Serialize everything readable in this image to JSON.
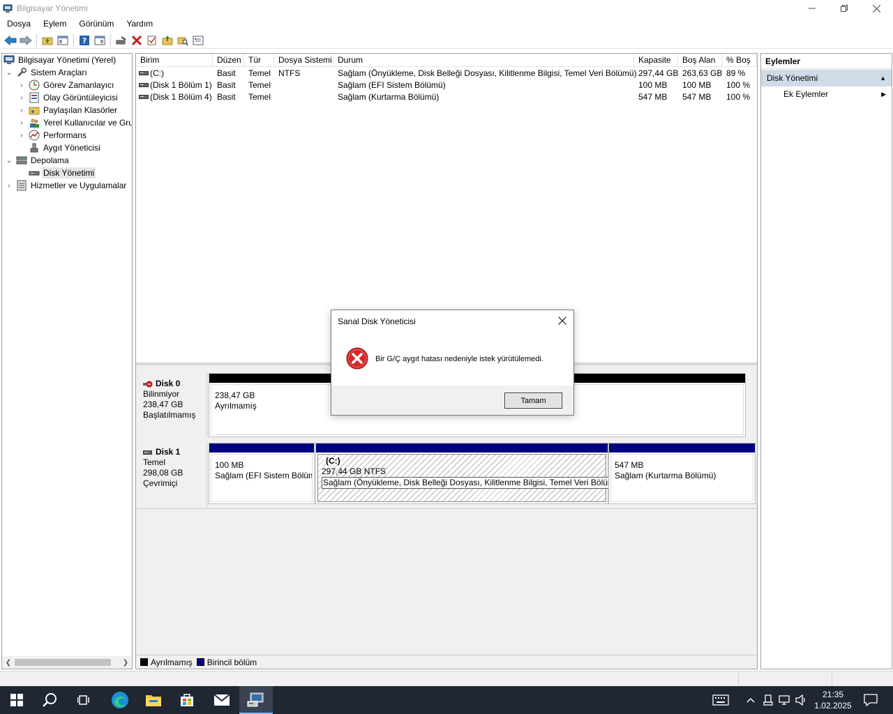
{
  "window": {
    "title": "Bilgisayar Yönetimi",
    "icon": "computer-management-icon"
  },
  "menu": [
    "Dosya",
    "Eylem",
    "Görünüm",
    "Yardım"
  ],
  "toolbar": {
    "icons": [
      "back-icon",
      "forward-icon",
      "up-folder-icon",
      "show-hide-tree-icon",
      "help-icon",
      "properties-pane-icon",
      "connect-disk-icon",
      "delete-icon",
      "check-icon",
      "open-folder-icon",
      "search-folder-icon",
      "properties-icon"
    ]
  },
  "tree": {
    "root": "Bilgisayar Yönetimi (Yerel)",
    "system_tools": "Sistem Araçları",
    "task_scheduler": "Görev Zamanlayıcı",
    "event_viewer": "Olay Görüntüleyicisi",
    "shared_folders": "Paylaşılan Klasörler",
    "local_users": "Yerel Kullanıcılar ve Gru",
    "performance": "Performans",
    "device_manager": "Aygıt Yöneticisi",
    "storage": "Depolama",
    "disk_management": "Disk Yönetimi",
    "services": "Hizmetler ve Uygulamalar"
  },
  "volumes": {
    "headers": {
      "volume": "Birim",
      "layout": "Düzen",
      "type": "Tür",
      "fs": "Dosya Sistemi",
      "status": "Durum",
      "capacity": "Kapasite",
      "free": "Boş Alan",
      "pct": "% Boş"
    },
    "rows": [
      {
        "volume": "(C:)",
        "layout": "Basit",
        "type": "Temel",
        "fs": "NTFS",
        "status": "Sağlam (Önyükleme, Disk Belleği Dosyası, Kilitlenme Bilgisi, Temel Veri Bölümü)",
        "capacity": "297,44 GB",
        "free": "263,63 GB",
        "pct": "89 %"
      },
      {
        "volume": "(Disk 1 Bölüm 1)",
        "layout": "Basit",
        "type": "Temel",
        "fs": "",
        "status": "Sağlam (EFI Sistem Bölümü)",
        "capacity": "100 MB",
        "free": "100 MB",
        "pct": "100 %"
      },
      {
        "volume": "(Disk 1 Bölüm 4)",
        "layout": "Basit",
        "type": "Temel",
        "fs": "",
        "status": "Sağlam (Kurtarma Bölümü)",
        "capacity": "547 MB",
        "free": "547 MB",
        "pct": "100 %"
      }
    ]
  },
  "disks": {
    "disk0": {
      "name": "Disk 0",
      "type": "Bilinmiyor",
      "size": "238,47 GB",
      "state": "Başlatılmamış",
      "part_size": "238,47 GB",
      "part_status": "Ayrılmamış"
    },
    "disk1": {
      "name": "Disk 1",
      "type": "Temel",
      "size": "298,08 GB",
      "state": "Çevrimiçi",
      "p1_size": "100 MB",
      "p1_status": "Sağlam (EFI Sistem Bölüm",
      "p2_name": "(C:)",
      "p2_size": "297,44 GB NTFS",
      "p2_status": "Sağlam (Önyükleme, Disk Belleği Dosyası, Kilitlenme Bilgisi, Temel Veri Bölümü)",
      "p3_size": "547 MB",
      "p3_status": "Sağlam (Kurtarma Bölümü)"
    }
  },
  "legend": {
    "unallocated": "Ayrılmamış",
    "primary": "Birincil bölüm",
    "unallocated_color": "#000000",
    "primary_color": "#000080"
  },
  "actions": {
    "header": "Eylemler",
    "section": "Disk Yönetimi",
    "more": "Ek Eylemler"
  },
  "dialog": {
    "title": "Sanal Disk Yöneticisi",
    "message": "Bir G/Ç aygıt hatası nedeniyle istek yürütülemedi.",
    "ok": "Tamam",
    "icon": "error-icon"
  },
  "taskbar": {
    "apps": [
      "start-icon",
      "search-icon",
      "task-view-icon",
      "edge-icon",
      "file-explorer-icon",
      "store-icon",
      "mail-icon",
      "computer-management-icon"
    ],
    "time": "21:35",
    "date": "1.02.2025"
  }
}
